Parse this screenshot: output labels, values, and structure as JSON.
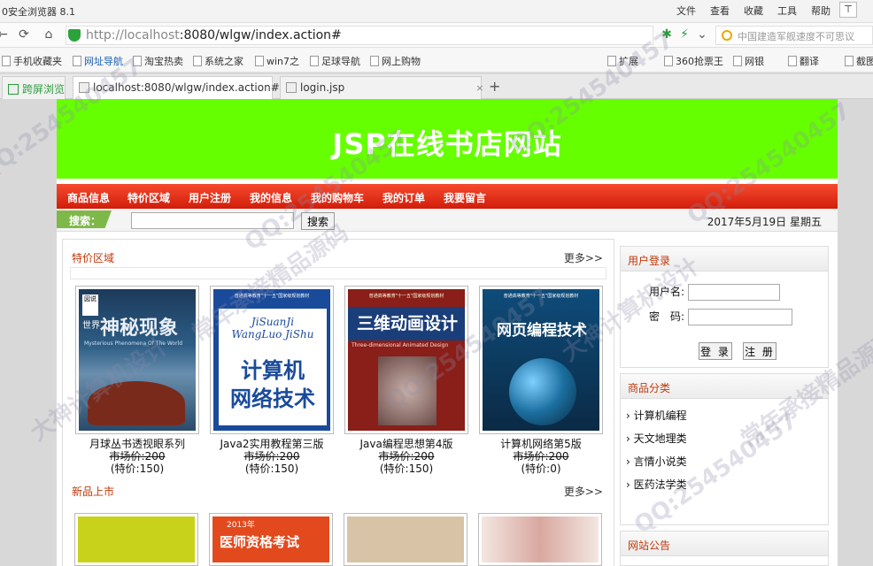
{
  "browser": {
    "title": "0安全浏览器 8.1",
    "menus": [
      "文件",
      "查看",
      "收藏",
      "工具",
      "帮助"
    ],
    "pin_label": "⊤",
    "url_host": "http://localhost",
    "url_path": ":8080/wlgw/index.action#",
    "search_placeholder": "中国建造军舰速度不可思议",
    "favorites": [
      "手机收藏夹",
      "网址导航",
      "淘宝热卖",
      "系统之家",
      "win7之",
      "足球导航",
      "网上购物"
    ],
    "extensions": [
      "扩展",
      "360抢票王",
      "网银",
      "翻译",
      "截图"
    ],
    "tabs": [
      {
        "label": "跨屏浏览"
      },
      {
        "label": "localhost:8080/wlgw/index.action#",
        "close": "×"
      },
      {
        "label": "login.jsp",
        "close": "×"
      }
    ],
    "new_tab": "+"
  },
  "site": {
    "title": "JSP在线书店网站",
    "nav": [
      "商品信息",
      "特价区域",
      "用户注册",
      "我的信息",
      "我的购物车",
      "我的订单",
      "我要留言"
    ],
    "search_label": "搜索：",
    "search_value": "",
    "search_button": "搜索",
    "date": "2017年5月19日 星期五"
  },
  "special": {
    "title": "特价区域",
    "more": "更多>>",
    "books": [
      {
        "name": "月球丛书透视眼系列",
        "market": "市场价:200",
        "special": "(特价:150)"
      },
      {
        "name": "Java2实用教程第三版",
        "market": "市场价:200",
        "special": "(特价:150)"
      },
      {
        "name": "Java编程思想第4版",
        "market": "市场价:200",
        "special": "(特价:150)"
      },
      {
        "name": "计算机网络第5版",
        "market": "市场价:200",
        "special": "(特价:0)"
      }
    ],
    "covers": [
      {
        "big": "神秘现象",
        "small": "世界",
        "sub": "Mysterious Phenomena Of The World"
      },
      {
        "top": "普通高等教育\"十一五\"国家级规划教材",
        "pinyin1": "JiSuanJi",
        "pinyin2": "WangLuo JiShu",
        "big1": "计算机",
        "big2": "网络技术"
      },
      {
        "top": "普通高等教育\"十一五\"国家级规划教材",
        "big": "三维动画设计",
        "sub": "Three-dimensional Animated Design"
      },
      {
        "top": "普通高等教育\"十一五\"国家级规划教材",
        "big": "网页编程技术"
      }
    ]
  },
  "newbooks": {
    "title": "新品上市",
    "more": "更多>>",
    "cover2_text": "医师资格考试",
    "cover2_year": "2013年"
  },
  "login": {
    "title": "用户登录",
    "user_label": "用户名:",
    "pass_label": "密　码:",
    "login_button": "登 录",
    "register_button": "注 册"
  },
  "categories": {
    "title": "商品分类",
    "items": [
      "计算机编程",
      "天文地理类",
      "言情小说类",
      "医药法学类"
    ]
  },
  "notice": {
    "title": "网站公告"
  },
  "watermark": [
    "QQ:254540457",
    "大神计算机设计",
    "常年承接精品源码"
  ]
}
